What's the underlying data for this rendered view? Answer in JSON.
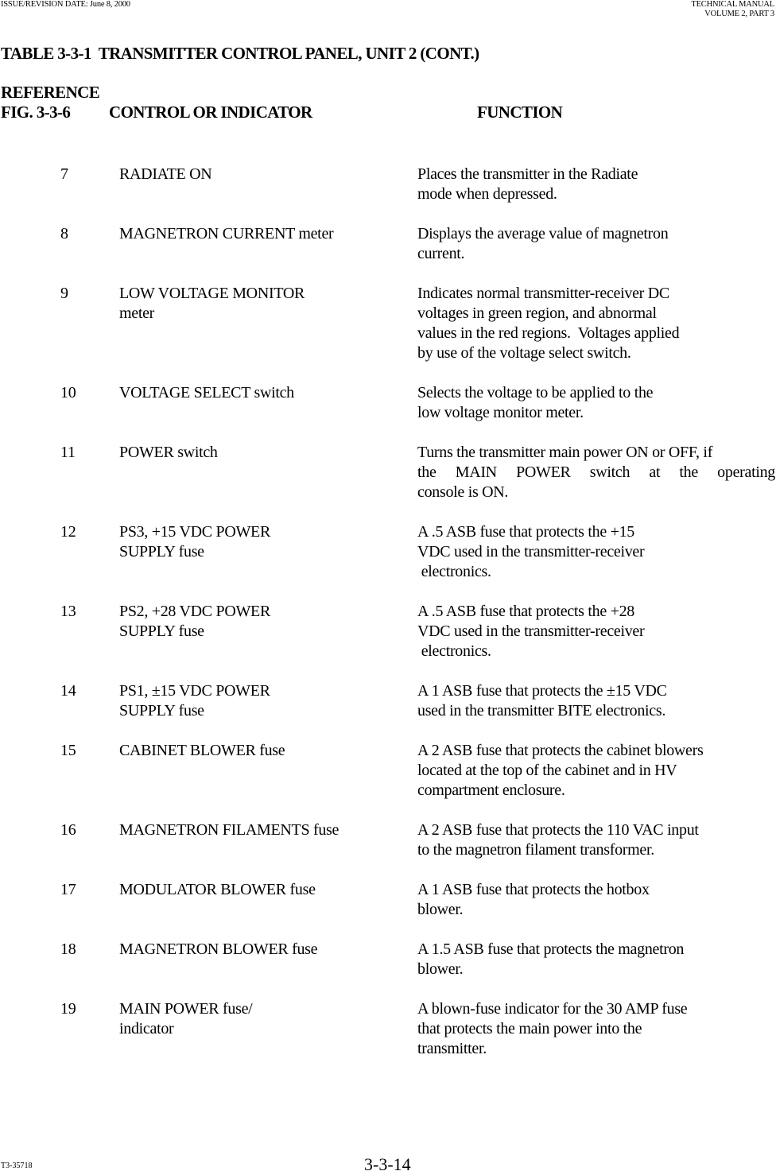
{
  "header": {
    "left": "ISSUE/REVISION DATE: June 8, 2000",
    "right_line1": "TECHNICAL MANUAL",
    "right_line2": "VOLUME 2, PART 3"
  },
  "table": {
    "title": "TABLE 3-3-1  TRANSMITTER CONTROL PANEL, UNIT 2 (CONT.)",
    "columns": {
      "reference_line1": "REFERENCE",
      "reference_line2": "FIG.  3-3-6",
      "control": "CONTROL OR INDICATOR",
      "function": "FUNCTION"
    },
    "rows": [
      {
        "ref": "7",
        "control": [
          "RADIATE ON"
        ],
        "function": [
          "Places the transmitter in the Radiate",
          "mode when depressed."
        ]
      },
      {
        "ref": "8",
        "control": [
          "MAGNETRON CURRENT meter"
        ],
        "function": [
          "Displays the average value of magnetron",
          "current."
        ]
      },
      {
        "ref": "9",
        "control": [
          "LOW VOLTAGE MONITOR",
          "meter"
        ],
        "function": [
          "Indicates normal transmitter-receiver DC",
          "voltages in green region, and abnormal",
          "values in the red regions.  Voltages applied",
          "by use of the voltage select switch."
        ]
      },
      {
        "ref": "10",
        "control": [
          "VOLTAGE SELECT switch"
        ],
        "function": [
          "Selects the voltage to be applied to the",
          "low voltage monitor meter."
        ]
      },
      {
        "ref": "11",
        "control": [
          "POWER switch"
        ],
        "function": [
          "Turns the transmitter main power ON or OFF, if",
          "the MAIN POWER switch at the operating",
          "console is ON."
        ]
      },
      {
        "ref": "12",
        "control": [
          "PS3, +15 VDC POWER",
          "SUPPLY fuse"
        ],
        "function": [
          "A .5 ASB fuse that protects the +15",
          "VDC used in the transmitter-receiver",
          " electronics."
        ]
      },
      {
        "ref": "13",
        "control": [
          "PS2, +28 VDC POWER",
          "SUPPLY fuse"
        ],
        "function": [
          "A .5 ASB fuse that protects the +28",
          "VDC used in the transmitter-receiver",
          " electronics."
        ]
      },
      {
        "ref": "14",
        "control": [
          "PS1, ±15 VDC POWER",
          "SUPPLY fuse"
        ],
        "function": [
          "A 1 ASB fuse that protects the ±15 VDC",
          "used in the transmitter BITE electronics."
        ]
      },
      {
        "ref": "15",
        "control": [
          "CABINET BLOWER fuse"
        ],
        "function": [
          "A 2 ASB fuse that protects the cabinet blowers",
          "located at the top of the cabinet and in HV",
          "compartment enclosure."
        ]
      },
      {
        "ref": "16",
        "control": [
          "MAGNETRON FILAMENTS fuse"
        ],
        "function": [
          "A 2 ASB fuse that protects the 110 VAC input",
          "to the magnetron filament transformer."
        ]
      },
      {
        "ref": "17",
        "control": [
          "MODULATOR BLOWER fuse"
        ],
        "function": [
          "A 1 ASB fuse that protects the hotbox",
          "blower."
        ]
      },
      {
        "ref": "18",
        "control": [
          "MAGNETRON BLOWER fuse"
        ],
        "function": [
          "A 1.5 ASB fuse that protects the magnetron",
          "blower."
        ]
      },
      {
        "ref": "19",
        "control": [
          "MAIN POWER fuse/",
          "indicator"
        ],
        "function": [
          "A blown-fuse indicator for the 30 AMP fuse",
          "that protects the main power into the",
          "transmitter."
        ]
      }
    ]
  },
  "footer": {
    "code": "T3-35718",
    "page": "3-3-14"
  }
}
